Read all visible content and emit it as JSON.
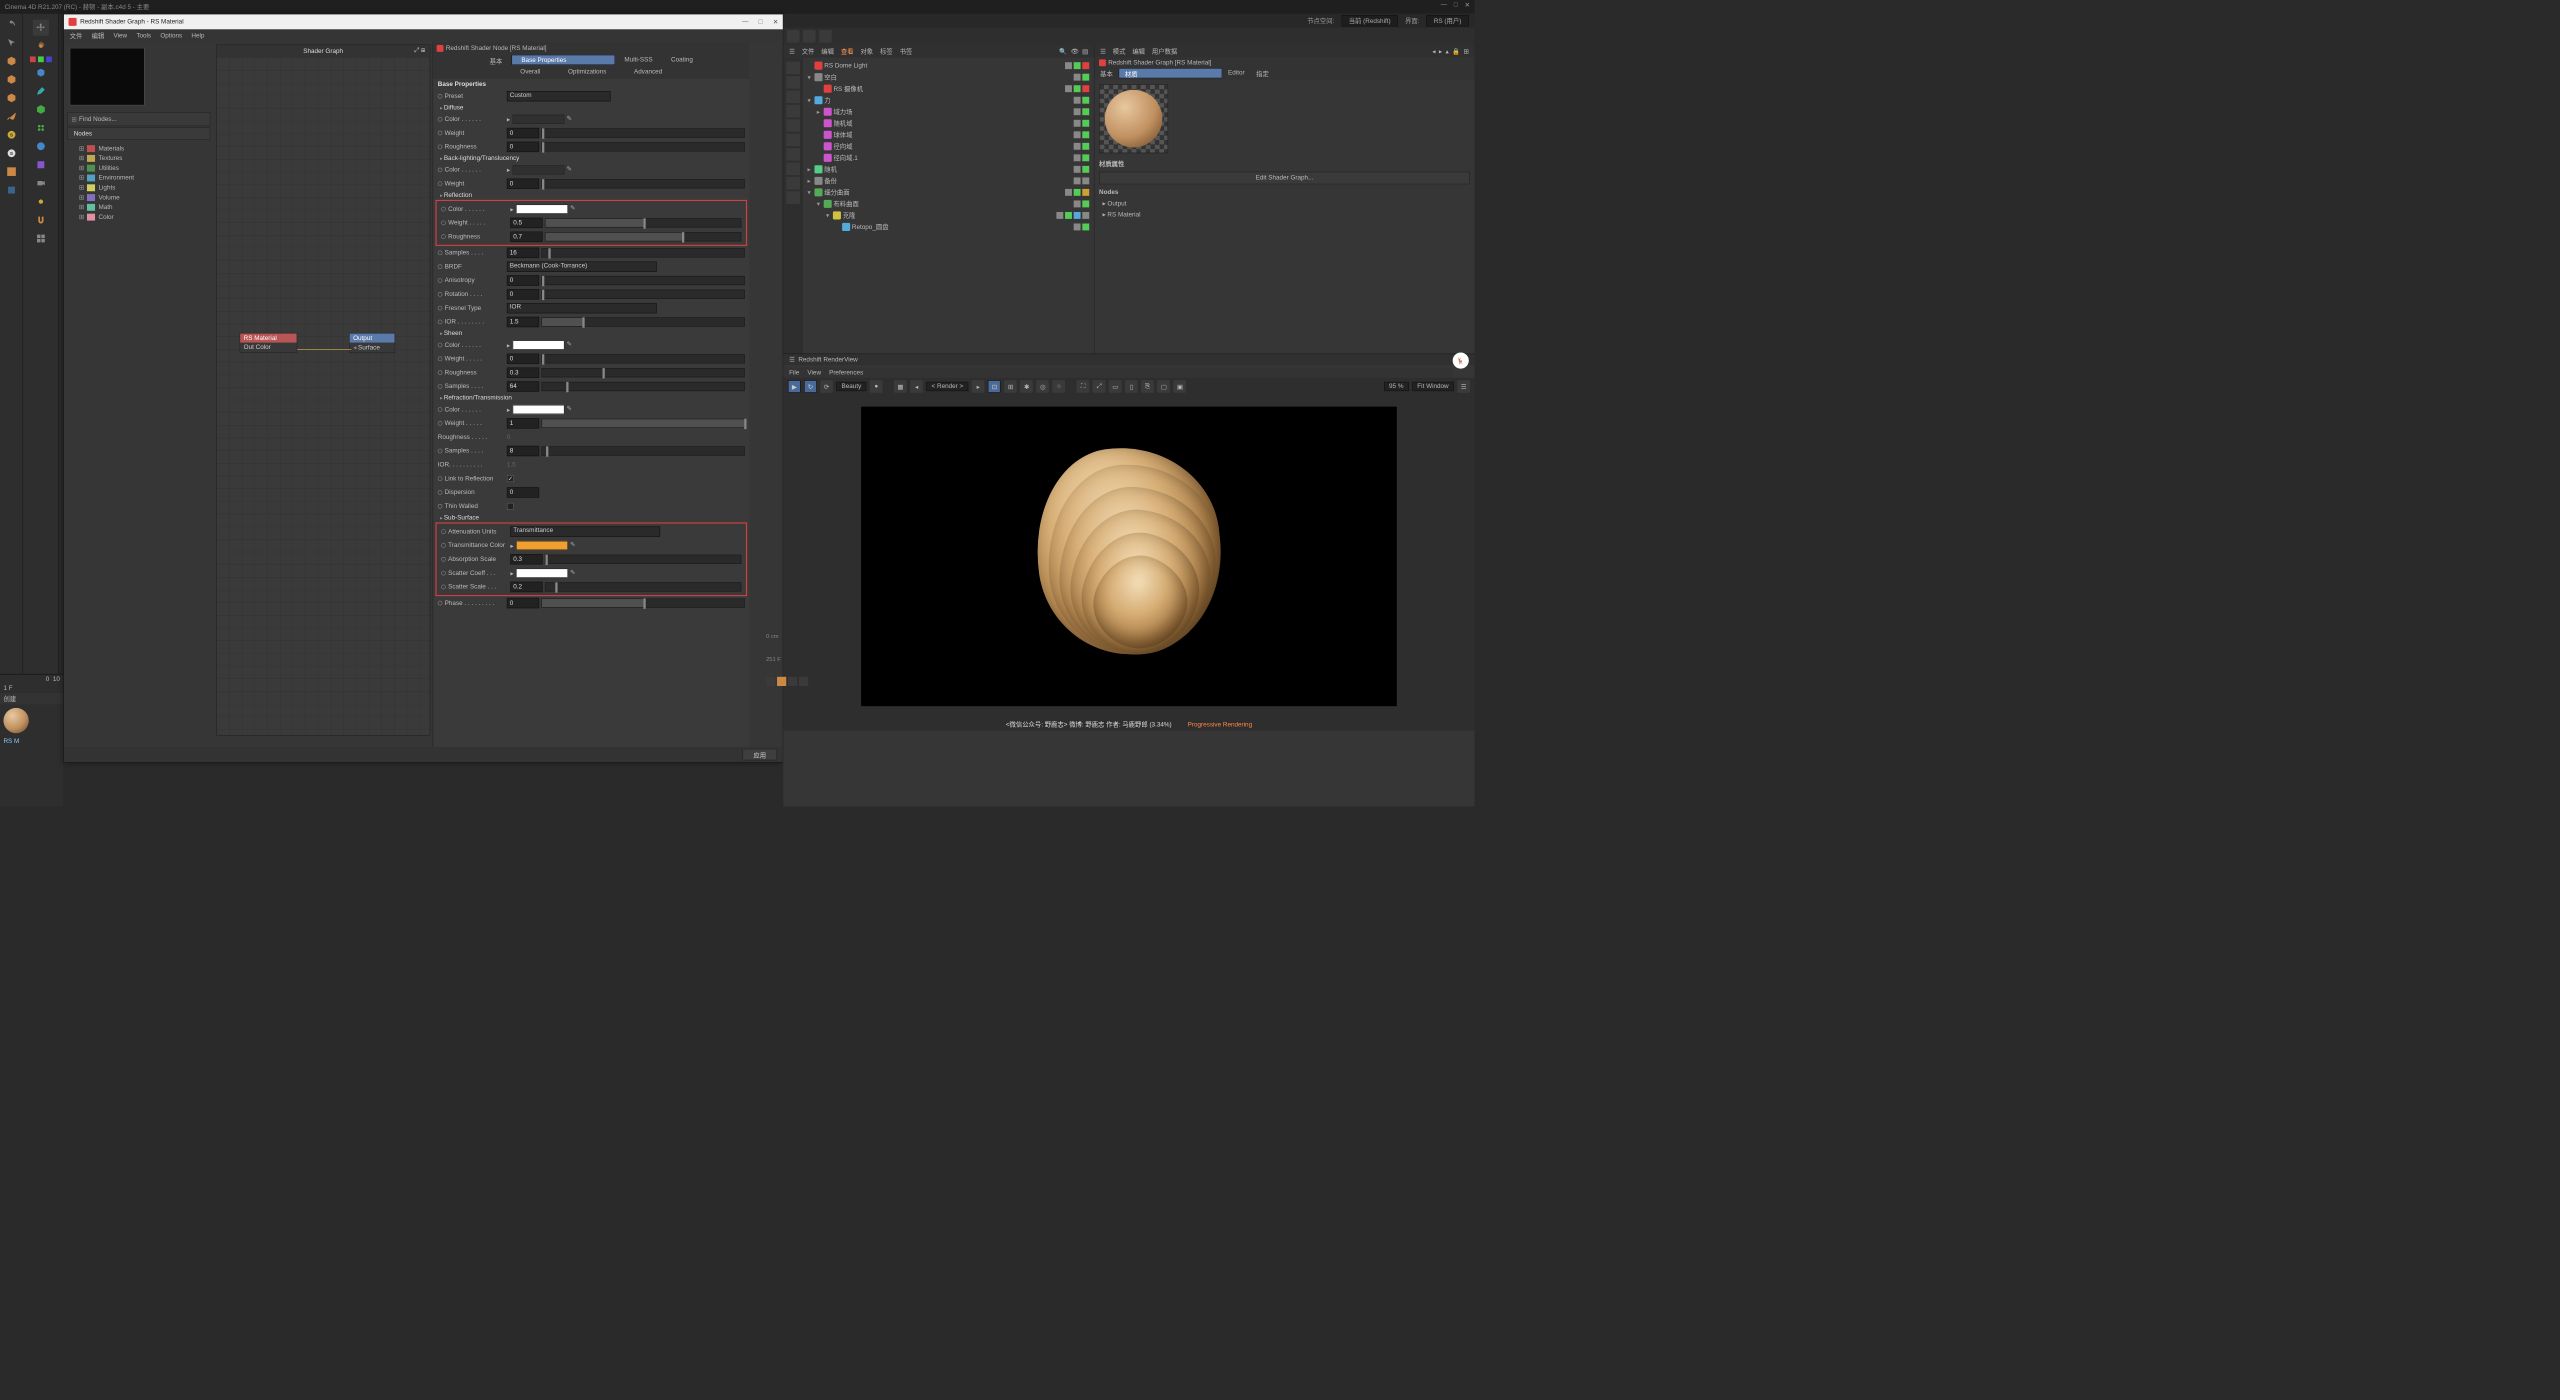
{
  "app_title": "Cinema 4D R21.207 (RC) - 赫顿 - 副本.c4d 5 - 主要",
  "sg_window": {
    "title": "Redshift Shader Graph - RS Material",
    "menu": [
      "文件",
      "编辑",
      "View",
      "Tools",
      "Options",
      "Help"
    ],
    "find_placeholder": "Find Nodes...",
    "nodes_header": "Nodes",
    "categories": [
      {
        "label": "Materials",
        "color": "#c05050"
      },
      {
        "label": "Textures",
        "color": "#c0a850"
      },
      {
        "label": "Utilities",
        "color": "#509050"
      },
      {
        "label": "Environment",
        "color": "#50a0c0"
      },
      {
        "label": "Lights",
        "color": "#d0d060"
      },
      {
        "label": "Volume",
        "color": "#8070c0"
      },
      {
        "label": "Math",
        "color": "#60c0a0"
      },
      {
        "label": "Color",
        "color": "#e090a0"
      }
    ],
    "canvas_title": "Shader Graph",
    "node_rs": {
      "title": "RS Material",
      "port": "Out Color"
    },
    "node_out": {
      "title": "Output",
      "port": "Surface"
    },
    "apply": "应用"
  },
  "inspector": {
    "title": "Redshift Shader Node [RS Material]",
    "main_tabs": [
      "基本",
      "Base Properties",
      "Multi-SSS",
      "Coating"
    ],
    "sub_tabs": [
      "Overall",
      "Optimizations",
      "Advanced"
    ],
    "section_title": "Base Properties",
    "preset": {
      "label": "Preset",
      "value": "Custom"
    },
    "diffuse": {
      "title": "Diffuse",
      "color_label": "Color",
      "color": "#303030",
      "weight_label": "Weight",
      "weight": "0",
      "roughness_label": "Roughness",
      "roughness": "0"
    },
    "backlight": {
      "title": "Back-lighting/Translucency",
      "color_label": "Color",
      "color": "#303030",
      "weight_label": "Weight",
      "weight": "0"
    },
    "reflection": {
      "title": "Reflection",
      "color_label": "Color",
      "color": "#ffffff",
      "weight_label": "Weight",
      "weight": "0.5",
      "weight_pct": 50,
      "roughness_label": "Roughness",
      "roughness": "0.7",
      "roughness_pct": 70,
      "samples_label": "Samples",
      "samples": "16",
      "brdf_label": "BRDF",
      "brdf": "Beckmann (Cook-Torrance)",
      "aniso_label": "Anisotropy",
      "aniso": "0",
      "rotation_label": "Rotation",
      "rotation": "0",
      "fresnel_label": "Fresnel Type",
      "fresnel": "IOR",
      "ior_label": "IOR",
      "ior": "1.5",
      "ior_pct": 20
    },
    "sheen": {
      "title": "Sheen",
      "color_label": "Color",
      "color": "#ffffff",
      "weight_label": "Weight",
      "weight": "0",
      "roughness_label": "Roughness",
      "roughness": "0.3",
      "samples_label": "Samples",
      "samples": "64"
    },
    "refraction": {
      "title": "Refraction/Transmission",
      "color_label": "Color",
      "color": "#ffffff",
      "weight_label": "Weight",
      "weight": "1",
      "weight_pct": 100,
      "roughness_label": "Roughness",
      "roughness": "0",
      "samples_label": "Samples",
      "samples": "8",
      "ior_label": "IOR",
      "ior": "1.5",
      "link_label": "Link to Reflection",
      "dispersion_label": "Dispersion",
      "dispersion": "0",
      "thin_label": "Thin Walled"
    },
    "subsurface": {
      "title": "Sub-Surface",
      "atten_label": "Attenuation Units",
      "atten": "Transmittance",
      "trans_label": "Transmittance Color",
      "trans_color": "#f0a030",
      "abs_label": "Absorption Scale",
      "abs": "0.3",
      "scatter_label": "Scatter Coeff",
      "scatter_color": "#ffffff",
      "sscale_label": "Scatter Scale",
      "sscale": "0.2",
      "phase_label": "Phase",
      "phase": "0"
    }
  },
  "c4d_top": {
    "node_space_label": "节点空间:",
    "node_space": "当前 (Redshift)",
    "layout_label": "界面:",
    "layout": "RS (用户)"
  },
  "obj_panel": {
    "menu": [
      "文件",
      "编辑",
      "查看",
      "对象",
      "标签",
      "书签"
    ],
    "items": [
      {
        "name": "RS Dome Light",
        "icon": "#e04040",
        "indent": 0,
        "tri": "",
        "tags": [
          "#888",
          "#55cc55",
          "#e04040"
        ]
      },
      {
        "name": "空白",
        "icon": "#888",
        "indent": 0,
        "tri": "▾",
        "tags": [
          "#888",
          "#55cc55"
        ]
      },
      {
        "name": "RS 摄像机",
        "icon": "#e04040",
        "indent": 1,
        "tri": "",
        "tags": [
          "#888",
          "#55cc55",
          "#e04040"
        ]
      },
      {
        "name": "力",
        "icon": "#55aadd",
        "indent": 0,
        "tri": "▾",
        "tags": [
          "#888",
          "#55cc55"
        ]
      },
      {
        "name": "域力场",
        "icon": "#cc55cc",
        "indent": 1,
        "tri": "▸",
        "tags": [
          "#888",
          "#55cc55"
        ]
      },
      {
        "name": "随机域",
        "icon": "#cc55cc",
        "indent": 1,
        "tri": "",
        "tags": [
          "#888",
          "#55cc55"
        ]
      },
      {
        "name": "球体域",
        "icon": "#cc55cc",
        "indent": 1,
        "tri": "",
        "tags": [
          "#888",
          "#55cc55"
        ]
      },
      {
        "name": "径向域",
        "icon": "#cc55cc",
        "indent": 1,
        "tri": "",
        "tags": [
          "#888",
          "#55cc55"
        ]
      },
      {
        "name": "径向域.1",
        "icon": "#cc55cc",
        "indent": 1,
        "tri": "",
        "tags": [
          "#888",
          "#55cc55"
        ]
      },
      {
        "name": "随机",
        "icon": "#55cc88",
        "indent": 0,
        "tri": "▸",
        "tags": [
          "#888",
          "#55cc55"
        ]
      },
      {
        "name": "备份",
        "icon": "#888",
        "indent": 0,
        "tri": "▸",
        "tags": [
          "#888",
          "#888"
        ]
      },
      {
        "name": "细分曲面",
        "icon": "#55aa55",
        "indent": 0,
        "tri": "▾",
        "tags": [
          "#888",
          "#55cc55",
          "#d0a030"
        ]
      },
      {
        "name": "布料曲面",
        "icon": "#55aa55",
        "indent": 1,
        "tri": "▾",
        "tags": [
          "#888",
          "#55cc55"
        ]
      },
      {
        "name": "克隆",
        "icon": "#d0c040",
        "indent": 2,
        "tri": "▾",
        "tags": [
          "#888",
          "#55cc55",
          "#55aadd",
          "#888"
        ]
      },
      {
        "name": "Retopo_圆盘",
        "icon": "#55aadd",
        "indent": 3,
        "tri": "",
        "tags": [
          "#888",
          "#55cc55"
        ]
      }
    ]
  },
  "attr_panel": {
    "menu": [
      "模式",
      "编辑",
      "用户数据"
    ],
    "title": "Redshift Shader Graph [RS Material]",
    "tabs": [
      "基本",
      "材质",
      "Editor",
      "指定"
    ],
    "mat_attr": "材质属性",
    "edit_btn": "Edit Shader Graph...",
    "nodes_hdr": "Nodes",
    "nodes": [
      "Output",
      "RS Material"
    ]
  },
  "renderview": {
    "title": "Redshift RenderView",
    "menu": [
      "File",
      "View",
      "Preferences"
    ],
    "channel": "Beauty",
    "aov": "< Render >",
    "pct": "95 %",
    "fit": "Fit Window",
    "status": "<微信公众号: 野鹿志>  微博: 野鹿志  作者: 马鹿野郎   (3.34%)",
    "prog": "Progressive Rendering"
  },
  "bottomleft": {
    "frame": "10",
    "f": "1 F",
    "create": "创建",
    "mat": "RS M"
  },
  "misc": {
    "cm": "0 cm",
    "f251": "251 F"
  }
}
